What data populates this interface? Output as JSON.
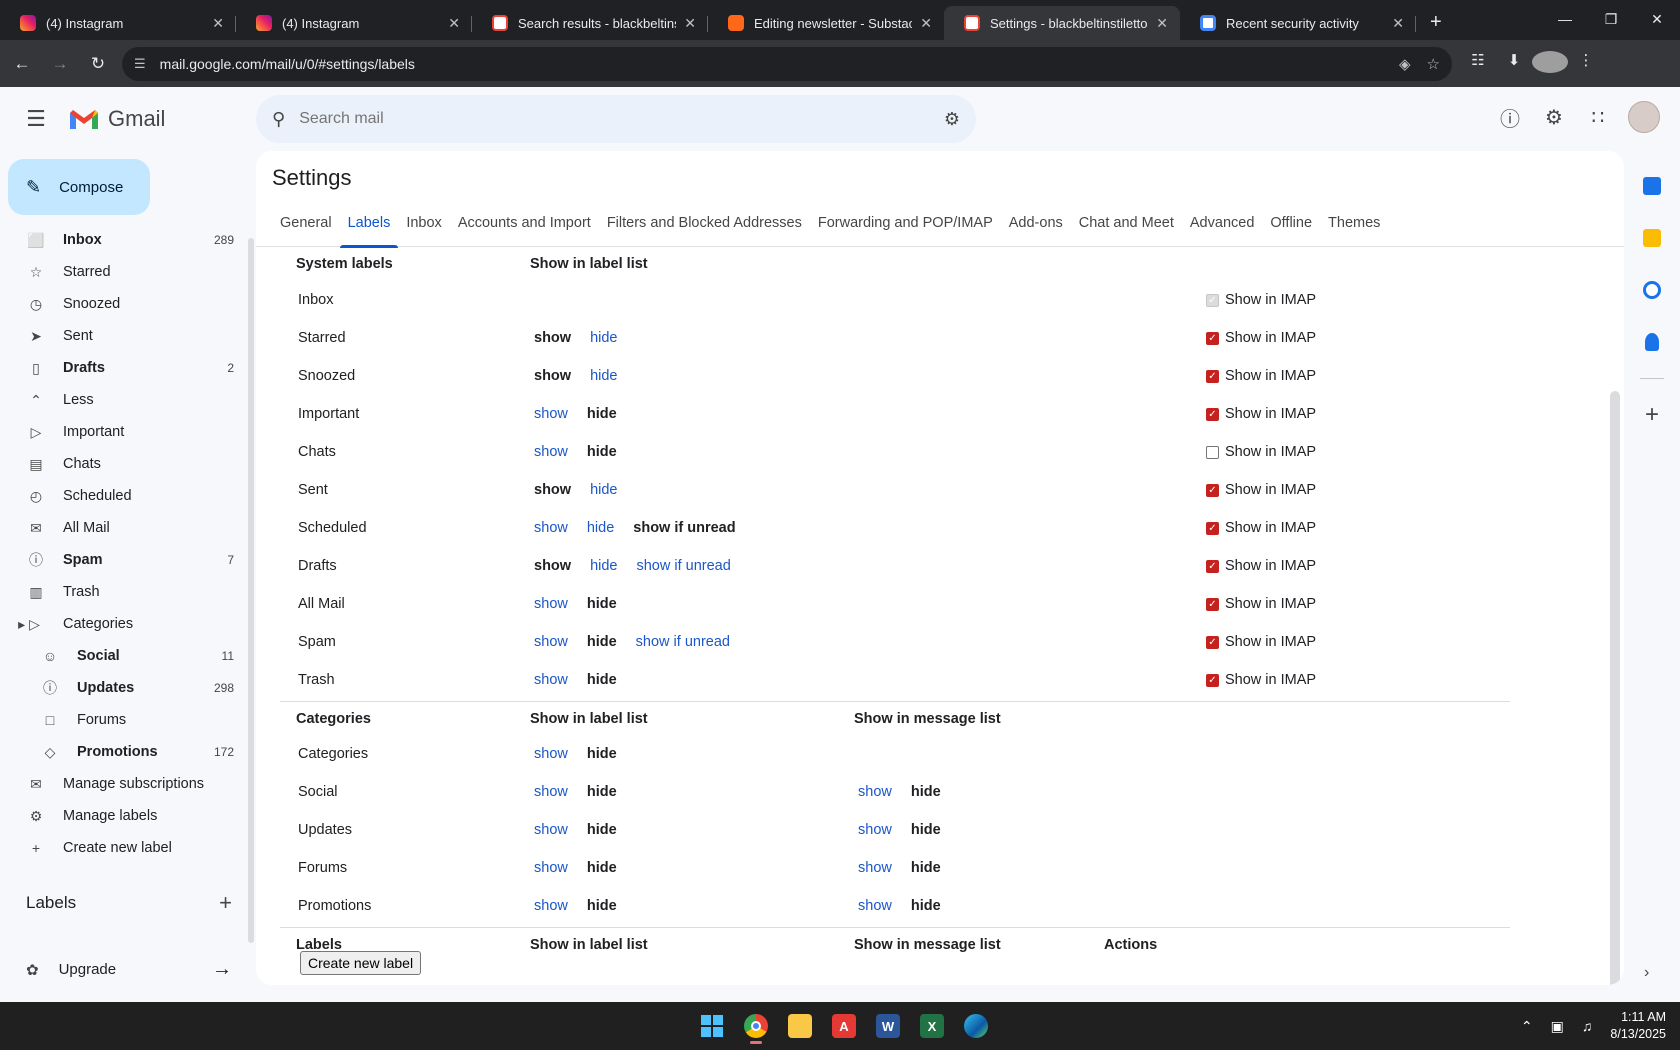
{
  "browser": {
    "tabs": [
      {
        "title": "(4) Instagram",
        "favicon": "instagram-icon",
        "active": false
      },
      {
        "title": "(4) Instagram",
        "favicon": "instagram-icon",
        "active": false
      },
      {
        "title": "Search results - blackbeltinstilet",
        "favicon": "gmail-icon",
        "active": false
      },
      {
        "title": "Editing newsletter - Substack",
        "favicon": "substack-icon",
        "active": false
      },
      {
        "title": "Settings - blackbeltinstilettos@",
        "favicon": "gmail-icon",
        "active": true
      },
      {
        "title": "Recent security activity",
        "favicon": "google-icon",
        "active": false
      }
    ],
    "url": "mail.google.com/mail/u/0/#settings/labels"
  },
  "gmail": {
    "logo_text": "Gmail",
    "search_placeholder": "Search mail",
    "compose_label": "Compose"
  },
  "sidebar": {
    "items": [
      {
        "label": "Inbox",
        "count": "289",
        "icon": "inbox-icon",
        "bold": true,
        "type": "item"
      },
      {
        "label": "Starred",
        "count": "",
        "icon": "star-icon",
        "bold": false,
        "type": "item"
      },
      {
        "label": "Snoozed",
        "count": "",
        "icon": "clock-icon",
        "bold": false,
        "type": "item"
      },
      {
        "label": "Sent",
        "count": "",
        "icon": "send-icon",
        "bold": false,
        "type": "item"
      },
      {
        "label": "Drafts",
        "count": "2",
        "icon": "draft-icon",
        "bold": true,
        "type": "item"
      },
      {
        "label": "Less",
        "count": "",
        "icon": "chevron-up-icon",
        "bold": false,
        "type": "item"
      },
      {
        "label": "Important",
        "count": "",
        "icon": "important-icon",
        "bold": false,
        "type": "item"
      },
      {
        "label": "Chats",
        "count": "",
        "icon": "chat-icon",
        "bold": false,
        "type": "item"
      },
      {
        "label": "Scheduled",
        "count": "",
        "icon": "scheduled-icon",
        "bold": false,
        "type": "item"
      },
      {
        "label": "All Mail",
        "count": "",
        "icon": "all-mail-icon",
        "bold": false,
        "type": "item"
      },
      {
        "label": "Spam",
        "count": "7",
        "icon": "spam-icon",
        "bold": true,
        "type": "item"
      },
      {
        "label": "Trash",
        "count": "",
        "icon": "trash-icon",
        "bold": false,
        "type": "item"
      },
      {
        "label": "Categories",
        "count": "",
        "icon": "label-icon",
        "bold": false,
        "type": "cat"
      },
      {
        "label": "Social",
        "count": "11",
        "icon": "social-icon",
        "bold": true,
        "type": "sub"
      },
      {
        "label": "Updates",
        "count": "298",
        "icon": "info-icon",
        "bold": true,
        "type": "sub"
      },
      {
        "label": "Forums",
        "count": "",
        "icon": "forum-icon",
        "bold": false,
        "type": "sub"
      },
      {
        "label": "Promotions",
        "count": "172",
        "icon": "tag-icon",
        "bold": true,
        "type": "sub"
      },
      {
        "label": "Manage subscriptions",
        "count": "",
        "icon": "unsubscribe-icon",
        "bold": false,
        "type": "item"
      },
      {
        "label": "Manage labels",
        "count": "",
        "icon": "gear-icon",
        "bold": false,
        "type": "item"
      },
      {
        "label": "Create new label",
        "count": "",
        "icon": "plus-icon",
        "bold": false,
        "type": "item"
      }
    ],
    "labels_heading": "Labels",
    "upgrade_label": "Upgrade"
  },
  "settings": {
    "title": "Settings",
    "tabs": [
      "General",
      "Labels",
      "Inbox",
      "Accounts and Import",
      "Filters and Blocked Addresses",
      "Forwarding and POP/IMAP",
      "Add-ons",
      "Chat and Meet",
      "Advanced",
      "Offline",
      "Themes"
    ],
    "active_tab": "Labels",
    "system_labels": {
      "header": {
        "c1": "System labels",
        "c2": "Show in label list"
      },
      "imap_text": "Show in IMAP",
      "rows": [
        {
          "name": "Inbox",
          "options": [],
          "selected": "",
          "imap": "disabled"
        },
        {
          "name": "Starred",
          "options": [
            "show",
            "hide"
          ],
          "selected": "show",
          "imap": "on"
        },
        {
          "name": "Snoozed",
          "options": [
            "show",
            "hide"
          ],
          "selected": "show",
          "imap": "on"
        },
        {
          "name": "Important",
          "options": [
            "show",
            "hide"
          ],
          "selected": "hide",
          "imap": "on"
        },
        {
          "name": "Chats",
          "options": [
            "show",
            "hide"
          ],
          "selected": "hide",
          "imap": "off"
        },
        {
          "name": "Sent",
          "options": [
            "show",
            "hide"
          ],
          "selected": "show",
          "imap": "on"
        },
        {
          "name": "Scheduled",
          "options": [
            "show",
            "hide",
            "show if unread"
          ],
          "selected": "show if unread",
          "imap": "on"
        },
        {
          "name": "Drafts",
          "options": [
            "show",
            "hide",
            "show if unread"
          ],
          "selected": "show",
          "imap": "on"
        },
        {
          "name": "All Mail",
          "options": [
            "show",
            "hide"
          ],
          "selected": "hide",
          "imap": "on"
        },
        {
          "name": "Spam",
          "options": [
            "show",
            "hide",
            "show if unread"
          ],
          "selected": "hide",
          "imap": "on"
        },
        {
          "name": "Trash",
          "options": [
            "show",
            "hide"
          ],
          "selected": "hide",
          "imap": "on"
        }
      ]
    },
    "categories": {
      "header": {
        "c1": "Categories",
        "c2": "Show in label list",
        "c3": "Show in message list"
      },
      "rows": [
        {
          "name": "Categories",
          "list": "hide",
          "message": ""
        },
        {
          "name": "Social",
          "list": "hide",
          "message": "hide"
        },
        {
          "name": "Updates",
          "list": "hide",
          "message": "hide"
        },
        {
          "name": "Forums",
          "list": "hide",
          "message": "hide"
        },
        {
          "name": "Promotions",
          "list": "hide",
          "message": "hide"
        }
      ]
    },
    "labels": {
      "header": {
        "c1": "Labels",
        "c2": "Show in label list",
        "c3": "Show in message list",
        "c4": "Actions"
      },
      "create_button": "Create new label"
    }
  },
  "taskbar": {
    "time": "1:11 AM",
    "date": "8/13/2025"
  },
  "colors": {
    "accent": "#0b57d0",
    "checkbox": "#c5221f",
    "compose_bg": "#c2e7ff"
  }
}
